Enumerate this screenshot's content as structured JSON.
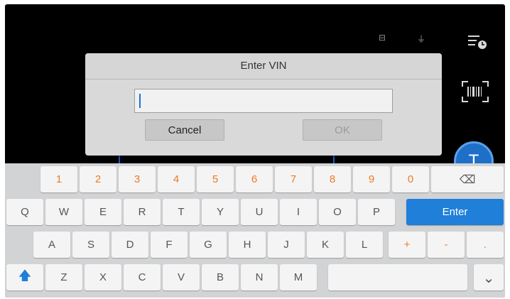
{
  "dialog": {
    "title": "Enter VIN",
    "vin_value": "",
    "cancel_label": "Cancel",
    "ok_label": "OK"
  },
  "status": {
    "left_glyph": "⊟",
    "right_glyph": "⏚"
  },
  "side_icons": {
    "history": "history-icon",
    "scan": "barcode-scan-icon",
    "fab_glyph": "T"
  },
  "keyboard": {
    "numbers": [
      "1",
      "2",
      "3",
      "4",
      "5",
      "6",
      "7",
      "8",
      "9",
      "0"
    ],
    "backspace": "⌫",
    "row_q": [
      "Q",
      "W",
      "E",
      "R",
      "T",
      "Y",
      "U",
      "I",
      "O",
      "P"
    ],
    "enter": "Enter",
    "row_a": [
      "A",
      "S",
      "D",
      "F",
      "G",
      "H",
      "J",
      "K",
      "L"
    ],
    "operators": [
      "+",
      "-",
      "."
    ],
    "shift": "🡅",
    "row_z": [
      "Z",
      "X",
      "C",
      "V",
      "B",
      "N",
      "M"
    ],
    "hide": "⌄"
  },
  "colors": {
    "accent": "#1f7fd9",
    "number_keys": "#f07a22",
    "background": "#000000",
    "keyboard_bg": "#d2d3d5"
  }
}
